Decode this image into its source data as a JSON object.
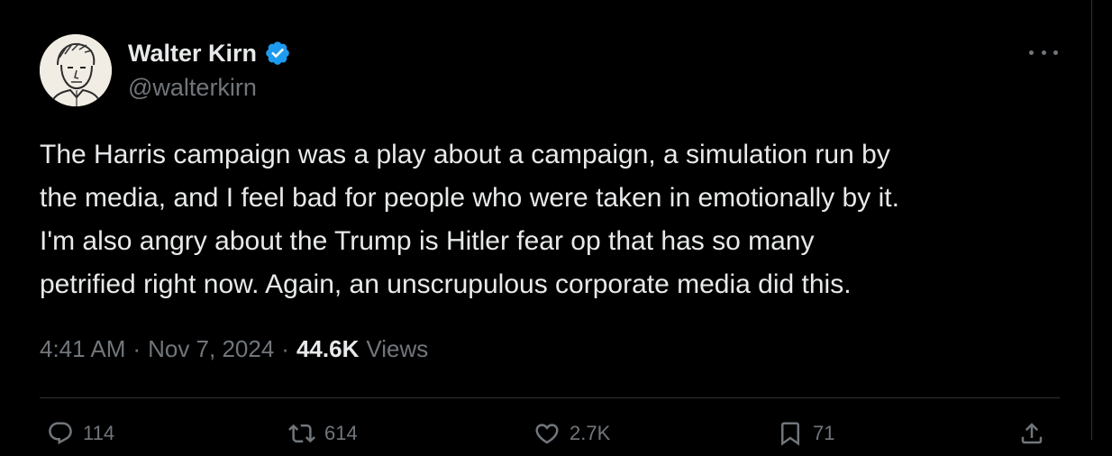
{
  "author": {
    "display_name": "Walter Kirn",
    "handle": "@walterkirn",
    "verified": true,
    "verified_color": "#1d9bf0"
  },
  "tweet": {
    "text": "The Harris campaign was a play about a campaign, a simulation run by\nthe media, and I feel bad for people who were taken in emotionally by it.\nI'm also angry about the Trump is Hitler fear op that has so many\npetrified right now. Again, an unscrupulous corporate media did this."
  },
  "meta": {
    "time": "4:41 AM",
    "separator": "·",
    "date": "Nov 7, 2024",
    "views_count": "44.6K",
    "views_label": "Views"
  },
  "actions": {
    "reply_count": "114",
    "repost_count": "614",
    "like_count": "2.7K",
    "bookmark_count": "71",
    "icons": [
      "reply-icon",
      "repost-icon",
      "like-icon",
      "bookmark-icon",
      "share-icon"
    ]
  },
  "colors": {
    "background": "#000000",
    "text_primary": "#e7e9ea",
    "text_secondary": "#71767b",
    "border": "#2f3336"
  }
}
